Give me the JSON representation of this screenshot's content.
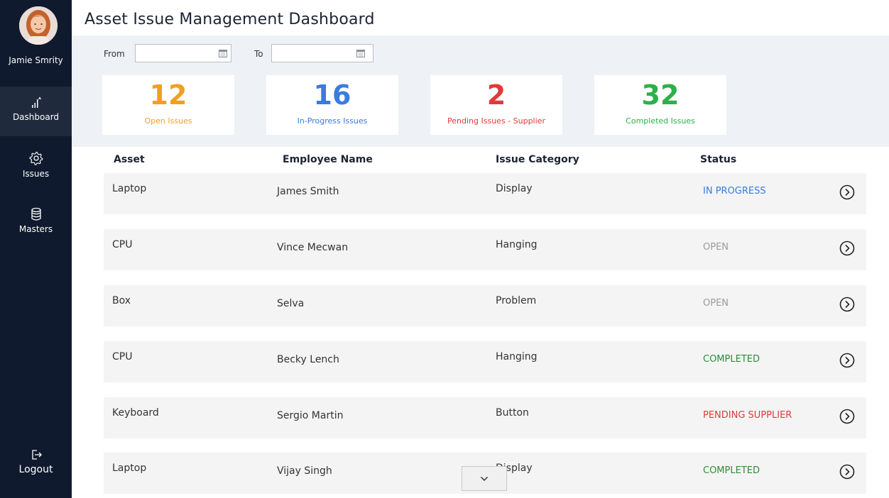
{
  "user": {
    "name": "Jamie Smrity"
  },
  "nav": {
    "dashboard": "Dashboard",
    "issues": "Issues",
    "masters": "Masters",
    "logout": "Logout"
  },
  "header": {
    "title": "Asset Issue Management Dashboard"
  },
  "filters": {
    "from_label": "From",
    "from_value": "",
    "to_label": "To",
    "to_value": ""
  },
  "stats": [
    {
      "value": "12",
      "label": "Open Issues",
      "color": "#f0a020"
    },
    {
      "value": "16",
      "label": "In-Progress Issues",
      "color": "#3a7be0"
    },
    {
      "value": "2",
      "label": "Pending Issues - Supplier",
      "color": "#e03a3a"
    },
    {
      "value": "32",
      "label": "Completed Issues",
      "color": "#2db04b"
    }
  ],
  "table": {
    "headers": [
      "Asset",
      "Employee Name",
      "Issue Category",
      "Status"
    ],
    "rows": [
      {
        "asset": "Laptop",
        "employee": "James Smith",
        "category": "Display",
        "status": "IN PROGRESS",
        "status_color": "#3a7be0"
      },
      {
        "asset": "CPU",
        "employee": "Vince Mecwan",
        "category": "Hanging",
        "status": "OPEN",
        "status_color": "#9a9a9a"
      },
      {
        "asset": "Box",
        "employee": "Selva",
        "category": "Problem",
        "status": "OPEN",
        "status_color": "#9a9a9a"
      },
      {
        "asset": "CPU",
        "employee": "Becky Lench",
        "category": "Hanging",
        "status": "COMPLETED",
        "status_color": "#2e8b3a"
      },
      {
        "asset": "Keyboard",
        "employee": "Sergio Martin",
        "category": "Button",
        "status": "PENDING SUPPLIER",
        "status_color": "#e03a3a"
      },
      {
        "asset": "Laptop",
        "employee": "Vijay Singh",
        "category": "Display",
        "status": "COMPLETED",
        "status_color": "#2e8b3a"
      }
    ]
  },
  "icons": {
    "dashboard": "bar-chart-icon",
    "issues": "gear-icon",
    "masters": "database-icon",
    "logout": "logout-icon",
    "row_action": "chevron-circle-right-icon",
    "scroll": "chevron-down-icon",
    "calendar": "calendar-icon"
  }
}
